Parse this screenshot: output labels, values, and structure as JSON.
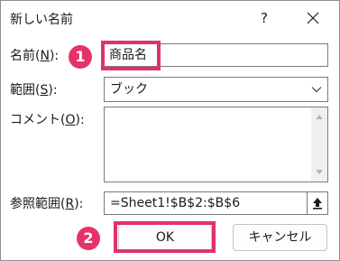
{
  "dialog": {
    "title": "新しい名前",
    "help_label": "?"
  },
  "name": {
    "label_pre": "名前(",
    "label_key": "N",
    "label_post": "):",
    "value": "商品名"
  },
  "scope": {
    "label_pre": "範囲(",
    "label_key": "S",
    "label_post": "):",
    "value": "ブック"
  },
  "comment": {
    "label_pre": "コメント(",
    "label_key": "O",
    "label_post": "):",
    "value": ""
  },
  "refers_to": {
    "label_pre": "参照範囲(",
    "label_key": "R",
    "label_post": "):",
    "value": "=Sheet1!$B$2:$B$6"
  },
  "buttons": {
    "ok": "OK",
    "cancel": "キャンセル"
  },
  "annotations": {
    "step1": "1",
    "step2": "2",
    "highlight_color": "#e5336a"
  },
  "icons": {
    "close": "close-icon",
    "dropdown": "chevron-down-icon",
    "collapse": "collapse-dialog-icon"
  }
}
